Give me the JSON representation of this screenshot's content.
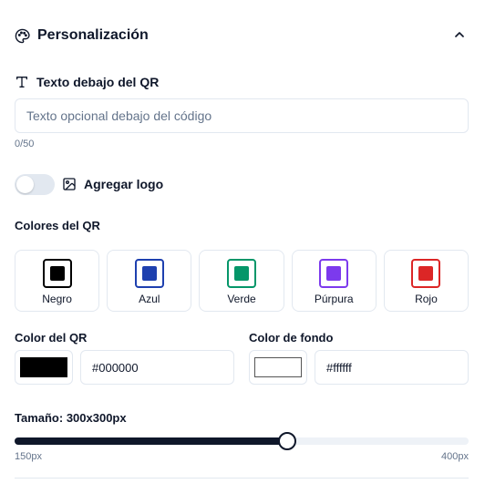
{
  "section": {
    "title": "Personalización",
    "icon": "palette-icon",
    "toggle_icon": "chevron-up-icon"
  },
  "text_below": {
    "label": "Texto debajo del QR",
    "icon": "text-icon",
    "placeholder": "Texto opcional debajo del código",
    "value": "",
    "counter": "0/50"
  },
  "logo": {
    "label": "Agregar logo",
    "icon": "image-icon",
    "enabled": false
  },
  "qr_colors": {
    "label": "Colores del QR",
    "options": [
      {
        "name": "Negro",
        "color": "#000000"
      },
      {
        "name": "Azul",
        "color": "#1e40af"
      },
      {
        "name": "Verde",
        "color": "#059669"
      },
      {
        "name": "Púrpura",
        "color": "#7c3aed"
      },
      {
        "name": "Rojo",
        "color": "#dc2626"
      }
    ]
  },
  "qr_color": {
    "label": "Color del QR",
    "swatch": "#000000",
    "value": "#000000"
  },
  "bg_color": {
    "label": "Color de fondo",
    "swatch": "#ffffff",
    "value": "#ffffff"
  },
  "size": {
    "label": "Tamaño: 300x300px",
    "min_label": "150px",
    "max_label": "400px",
    "min": 150,
    "max": 400,
    "value": 300
  }
}
